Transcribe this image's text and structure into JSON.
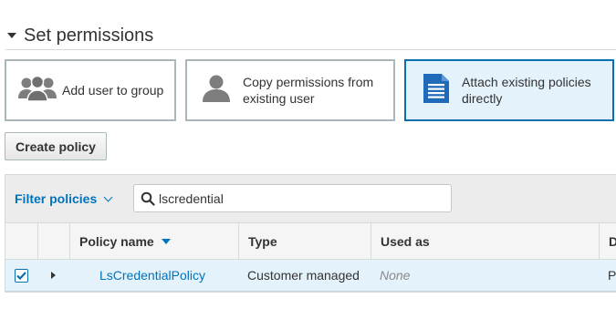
{
  "section": {
    "title": "Set permissions"
  },
  "options": [
    {
      "label": "Add user to group",
      "icon": "users-group-icon",
      "selected": false
    },
    {
      "label_line1": "Copy permissions from",
      "label_line2": "existing user",
      "icon": "user-icon",
      "selected": false
    },
    {
      "label_line1": "Attach existing policies",
      "label_line2": "directly",
      "icon": "document-icon",
      "selected": true
    }
  ],
  "create_policy_label": "Create policy",
  "filter": {
    "label": "Filter policies",
    "search_value": "lscredential"
  },
  "table": {
    "columns": [
      "Policy name",
      "Type",
      "Used as",
      "D"
    ],
    "rows": [
      {
        "checked": true,
        "name": "LsCredentialPolicy",
        "type": "Customer managed",
        "used_as": "None",
        "description": "Po"
      }
    ]
  },
  "colors": {
    "accent": "#0073bb",
    "selected_bg": "#e4f2fb",
    "selected_border": "#0b6fae"
  }
}
